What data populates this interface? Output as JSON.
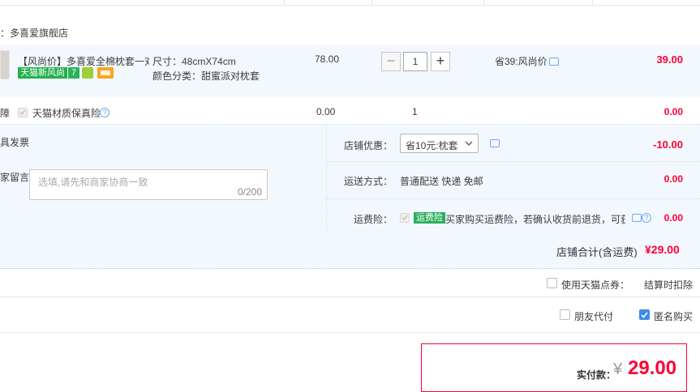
{
  "store": {
    "prefix": "：",
    "name": "多喜爱旗舰店"
  },
  "item": {
    "title": "【风尚价】多喜爱全棉枕套一对...",
    "badges": {
      "new_style": "天猫新风尚",
      "seven_day": "7"
    },
    "size": "尺寸：48cmX74cm",
    "color": "颜色分类：甜蜜派对枕套",
    "unit_price": "78.00",
    "quantity": "1",
    "qty_minus": "−",
    "qty_plus": "+",
    "promo": "省39:风尚价",
    "subtotal": "39.00"
  },
  "insurance": {
    "prefix": "障",
    "label": "天猫材质保真险",
    "help": "?",
    "price": "0.00",
    "qty": "1",
    "total": "0.00"
  },
  "invoice_label": "具发票",
  "message": {
    "label": "家留言：",
    "placeholder": "选填,请先和商家协商一致",
    "counter": "0/200"
  },
  "shop_discount": {
    "label": "店铺优惠：",
    "selected": "省10元:枕套",
    "amount": "-10.00"
  },
  "shipping": {
    "label": "运送方式：",
    "value": "普通配送 快递 免邮",
    "amount": "0.00"
  },
  "freight_insurance": {
    "label": "运费险：",
    "tag": "运费险",
    "text": "买家购买运费险，若确认收货前退货，可获...",
    "help": "?",
    "amount": "0.00"
  },
  "store_total": {
    "label": "店铺合计(含运费)",
    "amount": "¥29.00"
  },
  "points": {
    "label": "使用天猫点券：",
    "right": "结算时扣除"
  },
  "options": {
    "friend_pay": "朋友代付",
    "anonymous": "匿名购买"
  },
  "pay": {
    "label": "实付款：",
    "currency": "¥",
    "amount": "29.00"
  },
  "colors": {
    "accent_red": "#ff0036",
    "light_blue": "#f3f8fe",
    "checkbox_blue": "#3d8bf2"
  }
}
